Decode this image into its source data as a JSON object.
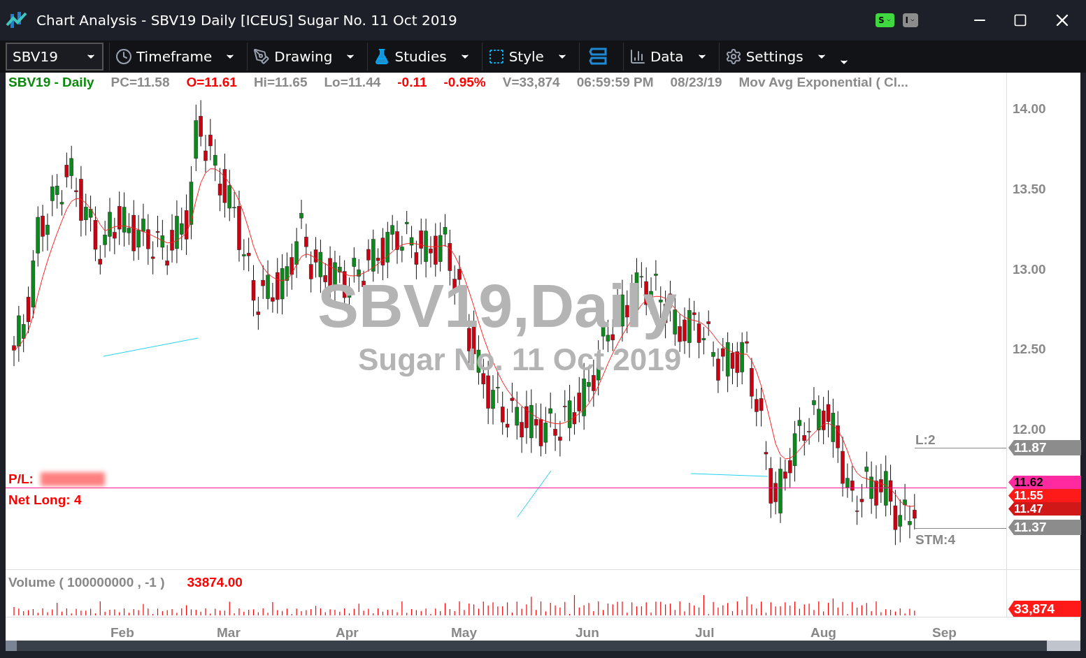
{
  "window": {
    "title": "Chart Analysis - SBV19 Daily [ICEUS] Sugar No. 11 Oct 2019",
    "badges": [
      {
        "label": "S",
        "color": "#3fd83f"
      },
      {
        "label": "I",
        "color": "#8c8c8c"
      }
    ]
  },
  "toolbar": {
    "symbol": "SBV19",
    "menus": [
      {
        "kind": "clock",
        "label": "Timeframe"
      },
      {
        "kind": "pen",
        "label": "Drawing"
      },
      {
        "kind": "flask",
        "label": "Studies"
      },
      {
        "kind": "frame",
        "label": "Style"
      },
      {
        "kind": "link"
      },
      {
        "kind": "bars",
        "label": "Data"
      },
      {
        "kind": "gear",
        "label": "Settings"
      }
    ]
  },
  "header": [
    {
      "text": "SBV19 - Daily",
      "color": "#0a8a0a"
    },
    {
      "text": "PC=11.58",
      "color": "#8a8a8a"
    },
    {
      "text": "O=11.61",
      "color": "#ff0000"
    },
    {
      "text": "Hi=11.65",
      "color": "#8a8a8a"
    },
    {
      "text": "Lo=11.44",
      "color": "#8a8a8a"
    },
    {
      "text": "-0.11",
      "color": "#ff0000"
    },
    {
      "text": "-0.95%",
      "color": "#ff0000"
    },
    {
      "text": "V=33,874",
      "color": "#8a8a8a"
    },
    {
      "text": "06:59:59 PM",
      "color": "#8a8a8a"
    },
    {
      "text": "08/23/19",
      "color": "#8a8a8a"
    },
    {
      "text": "Mov Avg Exponential ( Cl...",
      "color": "#8a8a8a"
    }
  ],
  "chart": {
    "watermark": {
      "symbol": "SBV19,Daily",
      "name": "Sugar No. 11 Oct 2019"
    },
    "y_ticks": [
      "14.00",
      "13.50",
      "13.00",
      "12.50",
      "12.00"
    ],
    "x_labels": [
      "Feb",
      "Mar",
      "Apr",
      "May",
      "Jun",
      "Jul",
      "Aug",
      "Sep"
    ],
    "pl_label": "P/L:",
    "net_position": "Net Long: 4",
    "order_lines": [
      {
        "label": "L:2",
        "tag": "11.87"
      },
      {
        "label": "STM:4",
        "tag": "11.37"
      }
    ],
    "price_tags": [
      {
        "text": "11.62",
        "color": "#ff2aa0"
      },
      {
        "text": "11.55",
        "color": "#ff1a1a"
      },
      {
        "text": "11.47",
        "color": "#d01818"
      }
    ]
  },
  "volume": {
    "label": "Volume ( 100000000 , -1 )",
    "value": "33874.00",
    "tag": "33,874"
  }
}
